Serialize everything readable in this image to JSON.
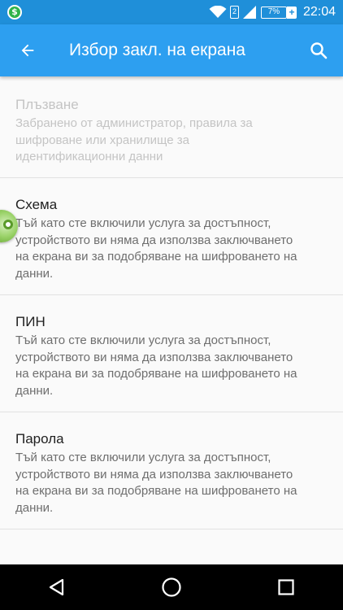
{
  "status_bar": {
    "app_icon_letter": "$",
    "sim_slot": "2",
    "battery_percent": "7%",
    "battery_charging_symbol": "+",
    "time": "22:04",
    "background_color": "#1f8fd9"
  },
  "app_bar": {
    "title": "Избор закл. на екрана",
    "back_icon": "arrow-back-icon",
    "search_icon": "search-icon",
    "background_color": "#2d9ff0"
  },
  "options": [
    {
      "title": "Плъзване",
      "summary": "Забранено от администратор, правила за\nшифроване или хранилище за\nидентификационни данни",
      "enabled": false
    },
    {
      "title": "Схема",
      "summary": "Тъй като сте включили услуга за достъпност,\nустройството ви няма да използва заключването\nна екрана ви за подобряване на шифроването на\nданни.",
      "enabled": true
    },
    {
      "title": "ПИН",
      "summary": "Тъй като сте включили услуга за достъпност,\nустройството ви няма да използва заключването\nна екрана ви за подобряване на шифроването на\nданни.",
      "enabled": true
    },
    {
      "title": "Парола",
      "summary": "Тъй като сте включили услуга за достъпност,\nустройството ви няма да използва заключването\nна екрана ви за подобряване на шифроването на\nданни.",
      "enabled": true
    }
  ],
  "nav_bar": {
    "back_icon": "triangle-back-icon",
    "home_icon": "circle-home-icon",
    "recents_icon": "square-recents-icon"
  }
}
